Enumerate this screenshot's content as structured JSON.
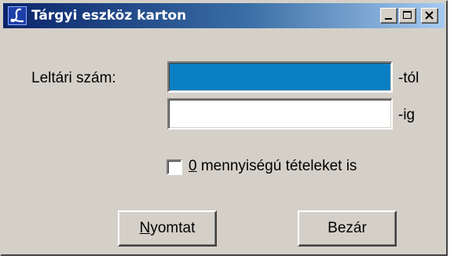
{
  "window": {
    "title": "Tárgyi eszköz karton",
    "icon": "script-L-icon",
    "controls": [
      "minimize",
      "maximize",
      "close"
    ]
  },
  "form": {
    "inventory_label": "Leltári szám:",
    "from_value": "",
    "from_suffix": "-tól",
    "to_value": "",
    "to_suffix": "-ig",
    "zero_qty_checkbox": {
      "mnemonic": "0",
      "label_rest": " mennyiségú tételeket is",
      "checked": false
    }
  },
  "buttons": {
    "print_mnemonic": "N",
    "print_rest": "yomtat",
    "close_label": "Bezár"
  },
  "colors": {
    "title_gradient_start": "#0a246a",
    "title_gradient_end": "#a6caf0",
    "window_bg": "#d4d0c8",
    "focused_field": "#0a7fc3"
  }
}
